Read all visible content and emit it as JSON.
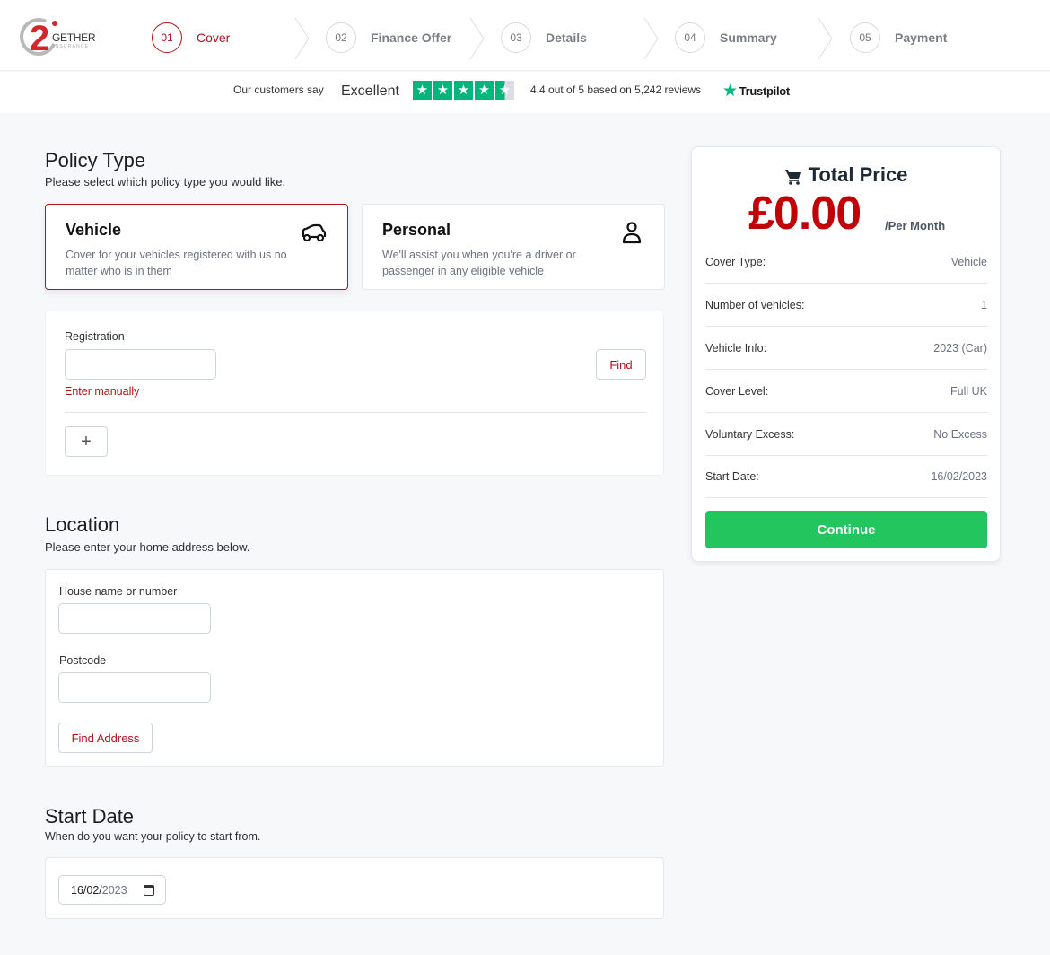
{
  "brand": {
    "logo_number": "2",
    "logo_word": "GETHER",
    "logo_sub": "INSURANCE"
  },
  "stepper": {
    "steps": [
      {
        "num": "01",
        "label": "Cover",
        "active": true
      },
      {
        "num": "02",
        "label": "Finance Offer",
        "active": false
      },
      {
        "num": "03",
        "label": "Details",
        "active": false
      },
      {
        "num": "04",
        "label": "Summary",
        "active": false
      },
      {
        "num": "05",
        "label": "Payment",
        "active": false
      }
    ]
  },
  "trustpilot": {
    "intro": "Our customers say",
    "rating_word": "Excellent",
    "rating": 4.4,
    "star_count": 5,
    "summary": "4.4 out of 5 based on 5,242 reviews",
    "brand": "Trustpilot",
    "color": "#00b67a"
  },
  "policy_type": {
    "heading": "Policy Type",
    "subheading": "Please select which policy type you would like.",
    "options": [
      {
        "title": "Vehicle",
        "description": "Cover for your vehicles registered with us no matter who is in them",
        "icon": "car-icon",
        "selected": true
      },
      {
        "title": "Personal",
        "description": "We'll assist you when you're a driver or passenger in any eligible vehicle",
        "icon": "person-icon",
        "selected": false
      }
    ]
  },
  "registration": {
    "label": "Registration",
    "value": "",
    "placeholder": "",
    "find_label": "Find",
    "manual_link": "Enter manually",
    "add_label": "+"
  },
  "location": {
    "heading": "Location",
    "subheading": "Please enter your home address below.",
    "house_label": "House name or number",
    "house_value": "",
    "postcode_label": "Postcode",
    "postcode_value": "",
    "find_address_label": "Find Address"
  },
  "start_date": {
    "heading": "Start Date",
    "subheading": "When do you want your policy to start from.",
    "day_month": "16/02/",
    "year": "2023"
  },
  "price_panel": {
    "title": "Total Price",
    "amount": "£0.00",
    "period": "/Per Month",
    "rows": [
      {
        "key": "Cover Type:",
        "value": "Vehicle"
      },
      {
        "key": "Number of vehicles:",
        "value": "1"
      },
      {
        "key": "Vehicle Info:",
        "value": "2023 (Car)"
      },
      {
        "key": "Cover Level:",
        "value": "Full UK"
      },
      {
        "key": "Voluntary Excess:",
        "value": "No Excess"
      },
      {
        "key": "Start Date:",
        "value": "16/02/2023"
      }
    ],
    "continue_label": "Continue"
  },
  "colors": {
    "brand_red": "#b0131b",
    "price_red": "#c20007",
    "continue_green": "#22c55e"
  }
}
